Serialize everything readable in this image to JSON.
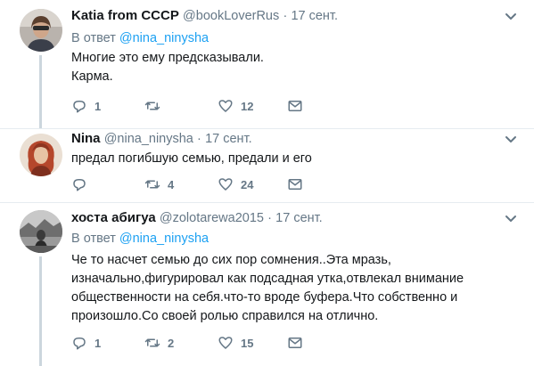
{
  "tweets": [
    {
      "name": "Katia from CCCP",
      "handle": "@bookLoverRus",
      "dot": "·",
      "time": "17 сент.",
      "reply_prefix": "В ответ",
      "reply_mention": "@nina_ninysha",
      "lines": [
        "Многие это ему предсказывали.",
        "Карма."
      ],
      "replies": "1",
      "retweets": "",
      "likes": "12"
    },
    {
      "name": "Nina",
      "handle": "@nina_ninysha",
      "dot": "·",
      "time": "17 сент.",
      "lines": [
        "предал погибшую  семью, предали и его"
      ],
      "replies": "",
      "retweets": "4",
      "likes": "24"
    },
    {
      "name": "хоста абигуа",
      "handle": "@zolotarewa2015",
      "dot": "·",
      "time": "17 сент.",
      "reply_prefix": "В ответ",
      "reply_mention": "@nina_ninysha",
      "lines": [
        "Че то насчет семью до сих пор сомнения..Эта мразь,",
        "изначально,фигурировал  как подсадная утка,отвлекал внимание",
        "общественности на себя.что-то вроде буфера.Что собственно и",
        "произошло.Со своей ролью справился на отлично."
      ],
      "replies": "1",
      "retweets": "2",
      "likes": "15"
    }
  ],
  "colors": {
    "text": "#14171a",
    "secondary": "#657786",
    "link": "#1da1f2",
    "thread_line": "#ccd6dd",
    "separator": "#e6ecf0"
  },
  "icons": {
    "reply": "reply-icon",
    "retweet": "retweet-icon",
    "like": "heart-icon",
    "dm": "envelope-icon",
    "more": "chevron-down-icon"
  }
}
